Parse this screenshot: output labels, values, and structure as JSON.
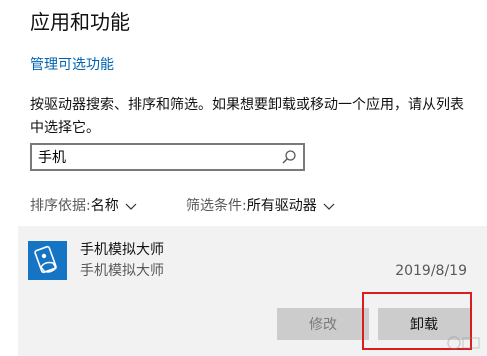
{
  "page": {
    "title": "应用和功能",
    "optional_features_link": "管理可选功能",
    "description": "按驱动器搜索、排序和筛选。如果想要卸载或移动一个应用，请从列表中选择它。"
  },
  "search": {
    "value": "手机",
    "icon": "search-icon"
  },
  "sort": {
    "label": "排序依据: ",
    "value": "名称"
  },
  "filter": {
    "label": "筛选条件: ",
    "value": "所有驱动器"
  },
  "app": {
    "name": "手机模拟大师",
    "publisher": "手机模拟大师",
    "date": "2019/8/19",
    "icon": "phone-emulator-app-icon",
    "modify_label": "修改",
    "uninstall_label": "卸载"
  },
  "colors": {
    "accent_link": "#0063b1",
    "highlight_box": "#d81e1e",
    "app_icon_bg": "#1574c4",
    "selected_panel_bg": "#f2f2f2"
  }
}
